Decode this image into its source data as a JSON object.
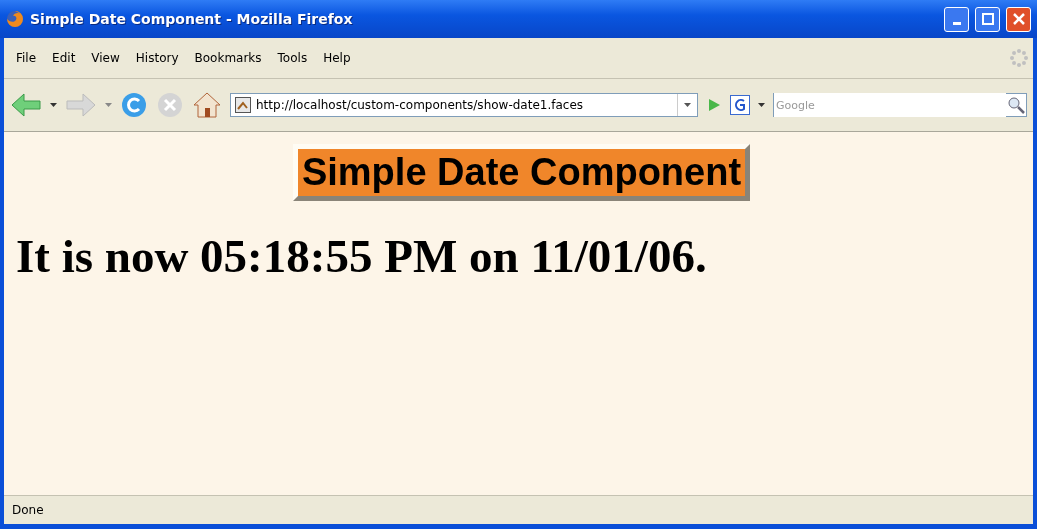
{
  "window": {
    "title": "Simple Date Component - Mozilla Firefox"
  },
  "menu": [
    "File",
    "Edit",
    "View",
    "History",
    "Bookmarks",
    "Tools",
    "Help"
  ],
  "address_bar": {
    "value": "http://localhost/custom-components/show-date1.faces"
  },
  "search": {
    "placeholder": "Google"
  },
  "page": {
    "heading": "Simple Date Component",
    "text": "It is now 05:18:55 PM on 11/01/06."
  },
  "status_bar": {
    "text": "Done"
  }
}
